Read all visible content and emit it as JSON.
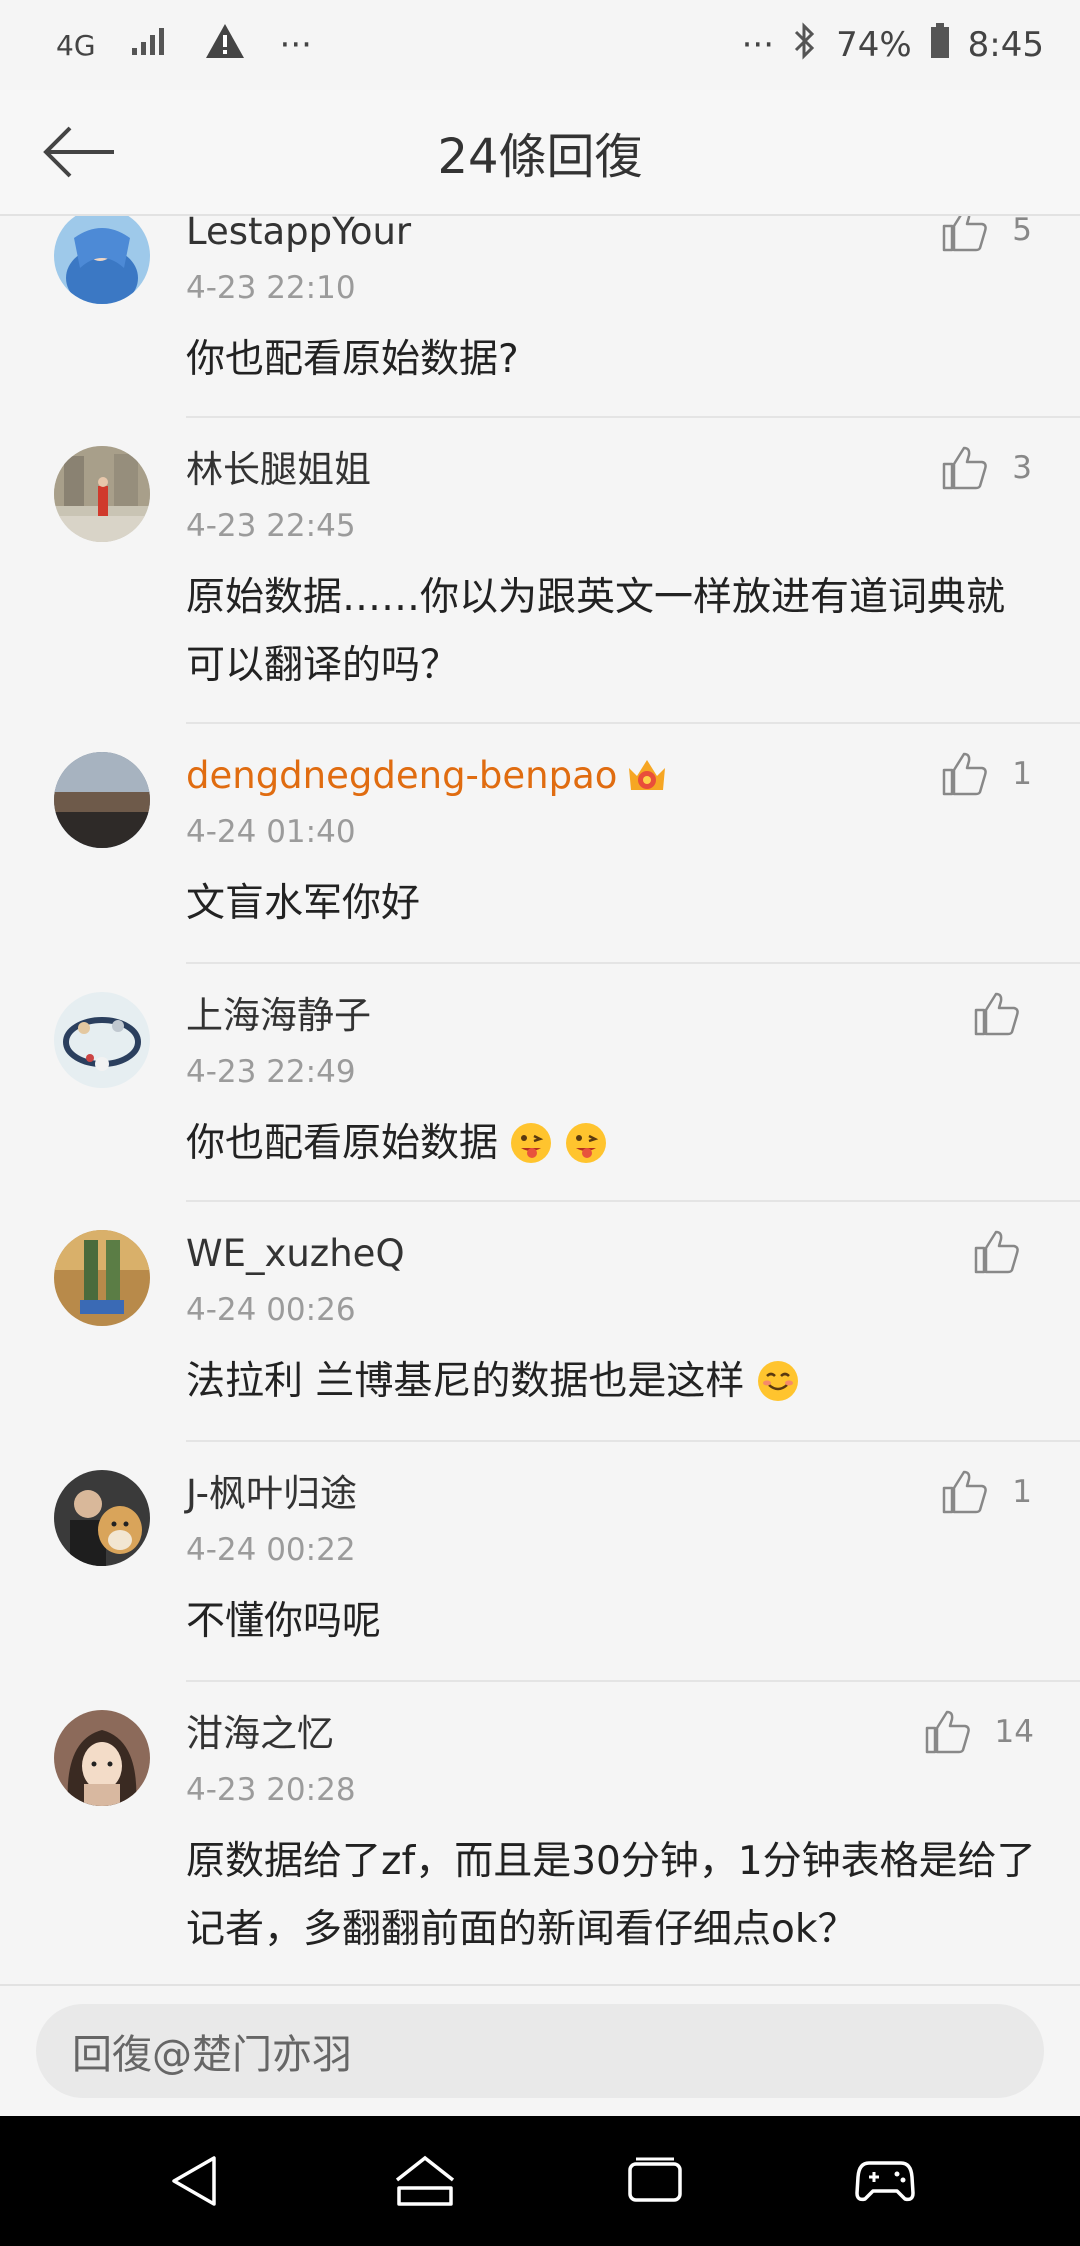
{
  "status_bar": {
    "network": "4G",
    "dots": "···",
    "right_dots": "···",
    "battery": "74%",
    "time": "8:45"
  },
  "header": {
    "title": "24條回復"
  },
  "comments": [
    {
      "user": "LestappYour",
      "time": "4-23 22:10",
      "text": "你也配看原始数据?",
      "likes": "5"
    },
    {
      "user": "林长腿姐姐",
      "time": "4-23 22:45",
      "text": "原始数据……你以为跟英文一样放进有道词典就可以翻译的吗？",
      "likes": "3"
    },
    {
      "user": "dengdnegdeng-benpao",
      "time": "4-24 01:40",
      "text": "文盲水军你好",
      "likes": "1"
    },
    {
      "user": "上海海静子",
      "time": "4-23 22:49",
      "text": "你也配看原始数据",
      "likes": ""
    },
    {
      "user": "WE_xuzheQ",
      "time": "4-24 00:26",
      "text": "法拉利 兰博基尼的数据也是这样",
      "likes": ""
    },
    {
      "user": "J-枫叶归途",
      "time": "4-24 00:22",
      "text": "不懂你吗呢",
      "likes": "1"
    },
    {
      "user": "泔海之忆",
      "time": "4-23 20:28",
      "text": "原数据给了zf，而且是30分钟，1分钟表格是给了记者，多翻翻前面的新闻看仔细点ok？",
      "likes": "14"
    }
  ],
  "reply": {
    "placeholder": "回復@楚门亦羽"
  },
  "colors": {
    "accent_orange": "#e06c10",
    "nav_bar": "#000000",
    "background": "#f5f5f5"
  }
}
